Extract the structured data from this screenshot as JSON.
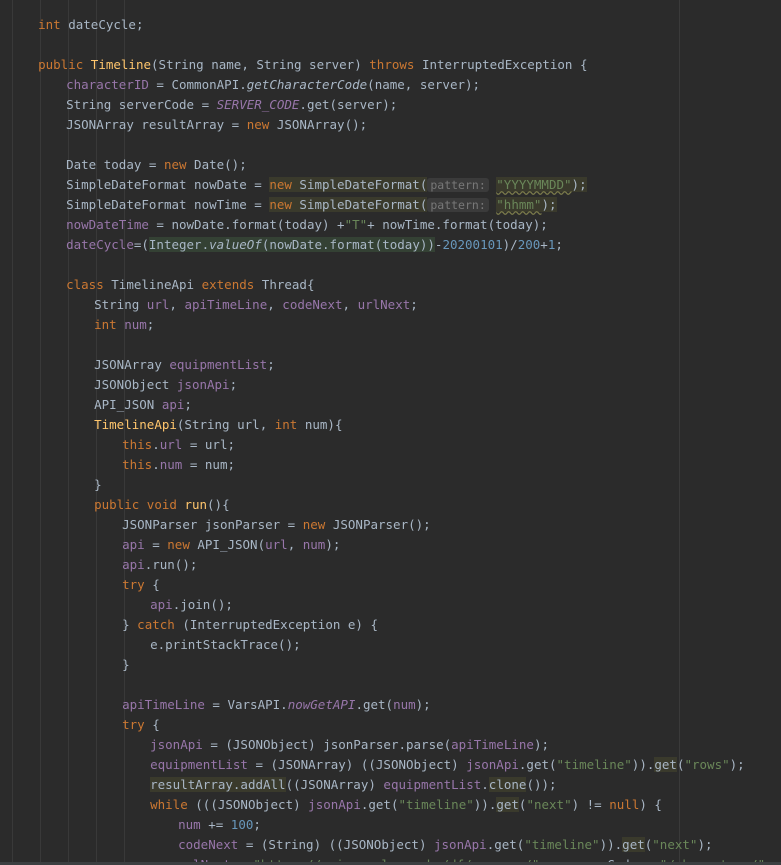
{
  "code": {
    "l1": {
      "k": "int",
      "t": " dateCycle;"
    },
    "l3": {
      "k1": "public ",
      "m": "Timeline",
      "a": "(String name, String server) ",
      "k2": "throws",
      "b": " InterruptedException {"
    },
    "l4": {
      "f": "characterID",
      "a": " = CommonAPI.",
      "mi": "getCharacterCode",
      "b": "(name, server);"
    },
    "l5": {
      "a": "String serverCode = ",
      "fi": "SERVER_CODE",
      "b": ".get(server);"
    },
    "l6": {
      "a": "JSONArray resultArray = ",
      "k": "new",
      "b": " JSONArray();"
    },
    "l8": {
      "a": "Date today = ",
      "k": "new",
      "b": " Date();"
    },
    "l9": {
      "a": "SimpleDateFormat nowDate = ",
      "k": "new",
      "b": " SimpleDateFormat(",
      "hint": "pattern:",
      "s": "\"YYYYMMDD\"",
      "c": ");"
    },
    "l10": {
      "a": "SimpleDateFormat nowTime = ",
      "k": "new",
      "b": " SimpleDateFormat(",
      "hint": "pattern:",
      "s": "\"hhmm\"",
      "c": ");"
    },
    "l11": {
      "f": "nowDateTime",
      "a": " = nowDate.format(today) +",
      "s": "\"T\"",
      "b": "+ nowTime.format(today);"
    },
    "l12": {
      "f": "dateCycle",
      "a": "=(",
      "h1": "Integer.",
      "mi": "valueOf",
      "h2": "(nowDate.format(today))",
      "b": "-",
      "n1": "20200101",
      "c": ")/",
      "n2": "200",
      "d": "+",
      "n3": "1",
      "e": ";"
    },
    "l14": {
      "k1": "class",
      "a": " TimelineApi ",
      "k2": "extends",
      "b": " Thread{"
    },
    "l15": {
      "a": "String ",
      "f1": "url",
      "b": ", ",
      "f2": "apiTimeLine",
      "c": ", ",
      "f3": "codeNext",
      "d": ", ",
      "f4": "urlNext",
      "e": ";"
    },
    "l16": {
      "k": "int",
      "a": " ",
      "f": "num",
      "b": ";"
    },
    "l18": {
      "a": "JSONArray ",
      "f": "equipmentList",
      "b": ";"
    },
    "l19": {
      "a": "JSONObject ",
      "f": "jsonApi",
      "b": ";"
    },
    "l20": {
      "a": "API_JSON ",
      "f": "api",
      "b": ";"
    },
    "l21": {
      "m": "TimelineApi",
      "a": "(String url, ",
      "k": "int",
      "b": " num){"
    },
    "l22": {
      "k": "this",
      "a": ".",
      "f": "url",
      "b": " = url;"
    },
    "l23": {
      "k": "this",
      "a": ".",
      "f": "num",
      "b": " = num;"
    },
    "l24": {
      "a": "}"
    },
    "l25": {
      "k1": "public ",
      "k2": "void",
      "a": " ",
      "m": "run",
      "b": "(){"
    },
    "l26": {
      "a": "JSONParser jsonParser = ",
      "k": "new",
      "b": " JSONParser();"
    },
    "l27": {
      "f1": "api",
      "a": " = ",
      "k": "new",
      "b": " API_JSON(",
      "f2": "url",
      "c": ", ",
      "f3": "num",
      "d": ");"
    },
    "l28": {
      "f": "api",
      "a": ".run();"
    },
    "l29": {
      "k": "try",
      "a": " {"
    },
    "l30": {
      "f": "api",
      "a": ".join();"
    },
    "l31": {
      "a": "} ",
      "k": "catch",
      "b": " (InterruptedException e) {"
    },
    "l32": {
      "a": "e.printStackTrace();"
    },
    "l33": {
      "a": "}"
    },
    "l35": {
      "f": "apiTimeLine",
      "a": " = VarsAPI.",
      "mi": "nowGetAPI",
      "b": ".get(",
      "f2": "num",
      "c": ");"
    },
    "l36": {
      "k": "try",
      "a": " {"
    },
    "l37": {
      "f1": "jsonApi",
      "a": " = (JSONObject) jsonParser.parse(",
      "f2": "apiTimeLine",
      "b": ");"
    },
    "l38": {
      "f1": "equipmentList",
      "a": " = (JSONArray) ((JSONObject) ",
      "f2": "jsonApi",
      "b": ".get(",
      "s1": "\"timeline\"",
      "c": ")).",
      "h": "get",
      "d": "(",
      "s2": "\"rows\"",
      "e": ");"
    },
    "l39": {
      "h1": "resultArray.addAll",
      "a": "((JSONArray) ",
      "f": "equipmentList",
      "b": ".",
      "h2": "clone",
      "c": "());"
    },
    "l40": {
      "k1": "while",
      "a": " (((JSONObject) ",
      "f": "jsonApi",
      "b": ".get(",
      "s1": "\"timeline\"",
      "c": ")).",
      "h": "get",
      "d": "(",
      "s2": "\"next\"",
      "e": ") != ",
      "k2": "null",
      "g": ") {"
    },
    "l41": {
      "f": "num",
      "a": " += ",
      "n": "100",
      "b": ";"
    },
    "l42": {
      "f1": "codeNext",
      "a": " = (String) ((JSONObject) ",
      "f2": "jsonApi",
      "b": ".get(",
      "s1": "\"timeline\"",
      "c": ")).",
      "h": "get",
      "d": "(",
      "s2": "\"next\"",
      "e": ");"
    },
    "l43": {
      "f": "urlNext",
      "a": " = ",
      "s1": "\"",
      "su": "https://api.neople.co.kr/df/servers/",
      "s2": "\"",
      "b": " + serverCode + ",
      "s3": "\"/characters/\"",
      "c": " + character"
    }
  },
  "colors": {
    "background": "#2b2b2b",
    "text": "#a9b7c6",
    "keyword": "#cc7832",
    "field": "#9876aa",
    "method": "#ffc66d",
    "string": "#6a8759",
    "number": "#6897bb"
  }
}
